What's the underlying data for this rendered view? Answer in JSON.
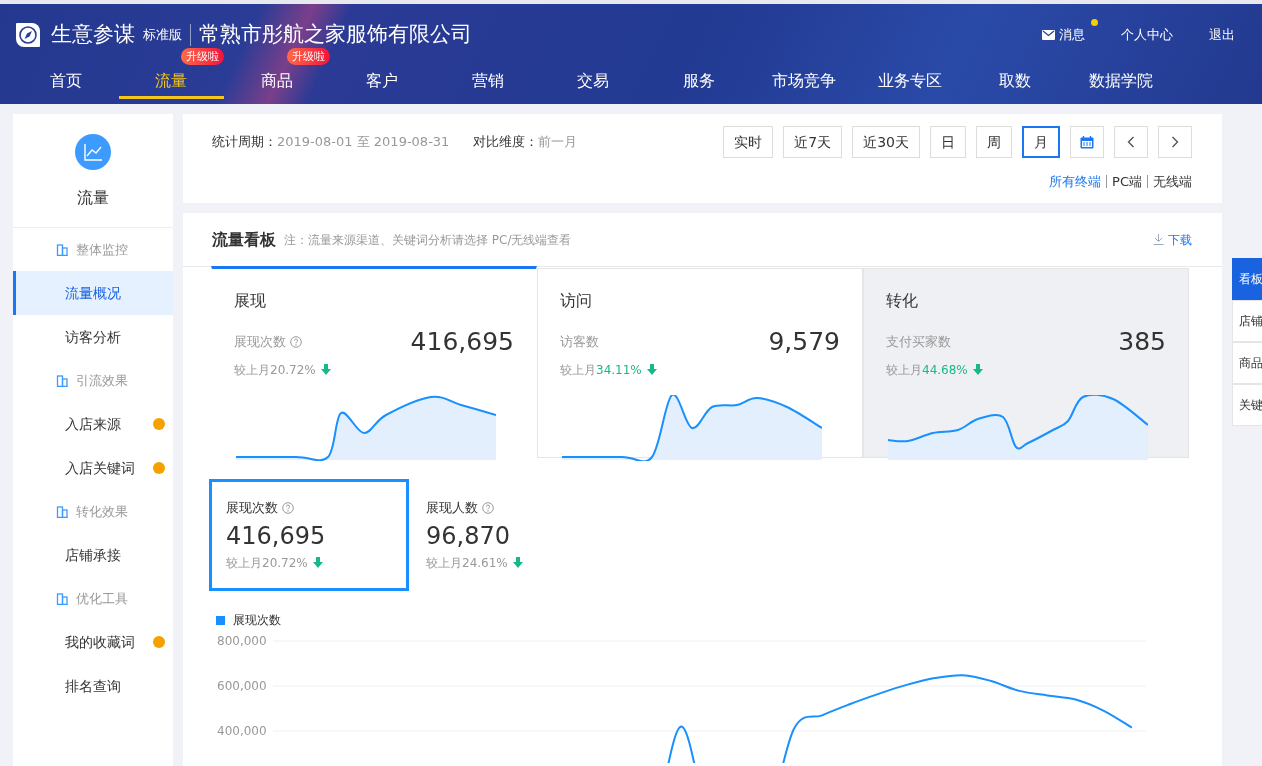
{
  "header": {
    "brand": "生意参谋",
    "edition": "标准版",
    "company": "常熟市彤航之家服饰有限公司",
    "links": [
      {
        "kind": "mail",
        "label": "消息",
        "unread": true
      },
      {
        "kind": "plain",
        "label": "个人中心"
      },
      {
        "kind": "plain",
        "label": "退出"
      }
    ],
    "nav": [
      {
        "label": "首页",
        "selected": false
      },
      {
        "label": "流量",
        "selected": true,
        "badge": "升级啦"
      },
      {
        "label": "商品",
        "selected": false,
        "badge": "升级啦"
      },
      {
        "label": "客户",
        "selected": false
      },
      {
        "label": "营销",
        "selected": false
      },
      {
        "label": "交易",
        "selected": false
      },
      {
        "label": "服务",
        "selected": false
      },
      {
        "label": "市场竞争",
        "selected": false
      },
      {
        "label": "业务专区",
        "selected": false
      },
      {
        "label": "取数",
        "selected": false
      },
      {
        "label": "数据学院",
        "selected": false
      }
    ]
  },
  "sidebar": {
    "title": "流量",
    "groups": [
      {
        "label": "整体监控",
        "items": [
          {
            "label": "流量概况",
            "selected": true,
            "dot": false
          },
          {
            "label": "访客分析",
            "selected": false,
            "dot": false
          }
        ]
      },
      {
        "label": "引流效果",
        "items": [
          {
            "label": "入店来源",
            "selected": false,
            "dot": true
          },
          {
            "label": "入店关键词",
            "selected": false,
            "dot": true
          }
        ]
      },
      {
        "label": "转化效果",
        "items": [
          {
            "label": "店铺承接",
            "selected": false,
            "dot": false
          }
        ]
      },
      {
        "label": "优化工具",
        "items": [
          {
            "label": "我的收藏词",
            "selected": false,
            "dot": true
          },
          {
            "label": "排名查询",
            "selected": false,
            "dot": false
          }
        ]
      }
    ]
  },
  "filters": {
    "period_label": "统计周期：",
    "period": "2019-08-01 至 2019-08-31",
    "compare_label": "对比维度：",
    "compare": "前一月",
    "ranges": [
      {
        "kind": "text",
        "label": "实时",
        "selected": false
      },
      {
        "kind": "text",
        "label": "近7天",
        "selected": false
      },
      {
        "kind": "text",
        "label": "近30天",
        "selected": false
      },
      {
        "kind": "text",
        "label": "日",
        "selected": false
      },
      {
        "kind": "text",
        "label": "周",
        "selected": false
      },
      {
        "kind": "text",
        "label": "月",
        "selected": true
      },
      {
        "kind": "calendar",
        "selected": false
      },
      {
        "kind": "prev",
        "selected": false
      },
      {
        "kind": "next",
        "selected": false
      }
    ],
    "terminals": [
      {
        "label": "所有终端",
        "selected": true
      },
      {
        "label": "PC端",
        "selected": false
      },
      {
        "label": "无线端",
        "selected": false
      }
    ]
  },
  "board": {
    "title": "流量看板",
    "note": "注：流量来源渠道、关键词分析请选择 PC/无线端查看",
    "download": "下载",
    "tabs": [
      {
        "title": "展现",
        "metric": "展现次数",
        "help": true,
        "value": "416,695",
        "compare_label": "较上月",
        "change": "20.72%",
        "declined": true,
        "selected": true,
        "hovered": false
      },
      {
        "title": "访问",
        "metric": "访客数",
        "help": false,
        "value": "9,579",
        "compare_label": "较上月",
        "change": "34.11%",
        "declined": true,
        "selected": false,
        "hovered": false
      },
      {
        "title": "转化",
        "metric": "支付买家数",
        "help": false,
        "value": "385",
        "compare_label": "较上月",
        "change": "44.68%",
        "declined": true,
        "selected": false,
        "hovered": true
      }
    ],
    "metrics": [
      {
        "label": "展现次数",
        "value": "416,695",
        "compare_label": "较上月",
        "change": "20.72%",
        "declined": true,
        "selected": true
      },
      {
        "label": "展现人数",
        "value": "96,870",
        "compare_label": "较上月",
        "change": "24.61%",
        "declined": true,
        "selected": false
      }
    ],
    "chart_data": {
      "type": "line",
      "ylim": [
        400000,
        800000
      ],
      "yticks": [
        {
          "value": 400000,
          "label": "400,000"
        },
        {
          "value": 600000,
          "label": "600,000"
        },
        {
          "value": 800000,
          "label": "800,000"
        }
      ],
      "series": [
        {
          "name": "展现次数",
          "color": "#1890ff",
          "values": [
            null,
            null,
            null,
            null,
            null,
            null,
            null,
            null,
            null,
            null,
            null,
            null,
            null,
            null,
            420000,
            null,
            null,
            null,
            410000,
            470000,
            520000,
            565000,
            605000,
            635000,
            648000,
            622000,
            578000,
            558000,
            540000,
            490000,
            415000
          ]
        }
      ]
    }
  },
  "side_tabs": [
    {
      "label": "看板",
      "selected": true
    },
    {
      "label": "店铺",
      "selected": false
    },
    {
      "label": "商品",
      "selected": false
    },
    {
      "label": "关键",
      "selected": false
    }
  ]
}
